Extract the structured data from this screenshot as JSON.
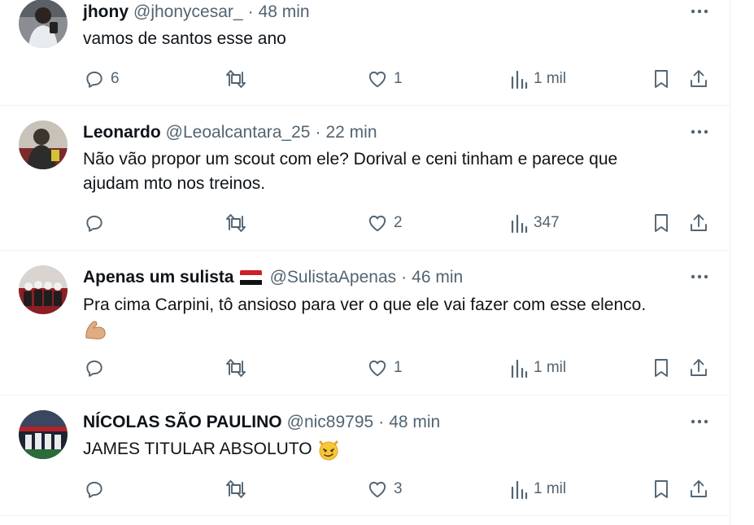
{
  "tweets": [
    {
      "name": "jhony",
      "handle": "@jhonycesar_",
      "time": "48 min",
      "text_lines": [
        "vamos de santos esse ano"
      ],
      "replies": "6",
      "retweets": "",
      "likes": "1",
      "views": "1 mil",
      "avatar_icon": "user-avatar-photo"
    },
    {
      "name": "Leonardo",
      "handle": "@Leoalcantara_25",
      "time": "22 min",
      "text_lines": [
        "Não vão propor um scout com ele? Dorival e ceni tinham e parece que",
        "ajudam mto nos treinos."
      ],
      "replies": "",
      "retweets": "",
      "likes": "2",
      "views": "347",
      "avatar_icon": "user-avatar-photo"
    },
    {
      "name": "Apenas um sulista",
      "name_flag_icon": "red-white-black-flag-icon",
      "handle": "@SulistaApenas",
      "time": "46 min",
      "text_lines": [
        "Pra cima Carpini, tô ansioso para ver o que ele vai fazer com esse elenco."
      ],
      "text_emoji": "flexed-biceps-emoji",
      "replies": "",
      "retweets": "",
      "likes": "1",
      "views": "1 mil",
      "avatar_icon": "user-avatar-photo"
    },
    {
      "name": "NÍCOLAS SÃO PAULINO",
      "handle": "@nic89795",
      "time": "48 min",
      "text_lines": [
        "JAMES TITULAR ABSOLUTO"
      ],
      "text_emoji": "smirking-devil-emoji",
      "replies": "",
      "retweets": "",
      "likes": "3",
      "views": "1 mil",
      "avatar_icon": "user-avatar-photo"
    }
  ],
  "colors": {
    "text": "#0f1419",
    "muted": "#536471",
    "divider": "#eff3f4"
  }
}
